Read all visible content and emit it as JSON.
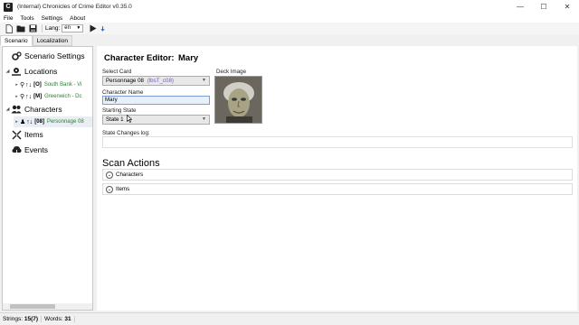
{
  "window": {
    "title": "(Internal) Chronicles of Crime Editor v0.35.0",
    "icon_name": "app-logo-icon",
    "controls": [
      "minimize-icon",
      "maximize-icon",
      "close-icon"
    ]
  },
  "menu": [
    "File",
    "Tools",
    "Settings",
    "About"
  ],
  "toolbar": {
    "icons": [
      "new-file-icon",
      "open-folder-icon",
      "save-icon"
    ],
    "lang_label": "Lang:",
    "lang_value": "en",
    "play_icon": "play-icon",
    "download_icon": "download-arrow-icon"
  },
  "tabs": [
    {
      "label": "Scenario",
      "active": true
    },
    {
      "label": "Localization",
      "active": false
    }
  ],
  "tree": {
    "scenario_settings": "Scenario Settings",
    "locations": "Locations",
    "location_items": [
      {
        "code": "[O]",
        "name": "South Bank - Vi"
      },
      {
        "code": "[M]",
        "name": "Greenwich - Dc"
      }
    ],
    "characters": "Characters",
    "character_items": [
      {
        "code": "[08]",
        "name": "Personnage 08"
      }
    ],
    "items": "Items",
    "events": "Events"
  },
  "editor": {
    "title": "Character Editor:",
    "name": "Mary",
    "select_card_label": "Select Card",
    "select_card_value": "Personnage 08",
    "select_card_suffix": "(lbsT_c08)",
    "character_name_label": "Character Name",
    "character_name_value": "Mary",
    "starting_state_label": "Starting State",
    "starting_state_value": "State 1",
    "deck_image_label": "Deck Image",
    "state_changes_label": "State Changes log:",
    "scan_actions_title": "Scan Actions",
    "scan_sections": [
      "Characters",
      "Items"
    ]
  },
  "status": {
    "strings_label": "Strings:",
    "strings_value": "15(7)",
    "words_label": "Words:",
    "words_value": "31"
  },
  "colors": {
    "accent_green": "#2e7d32",
    "accent_purple": "#7b5cb5",
    "selection_blue": "#7a9fd4"
  }
}
